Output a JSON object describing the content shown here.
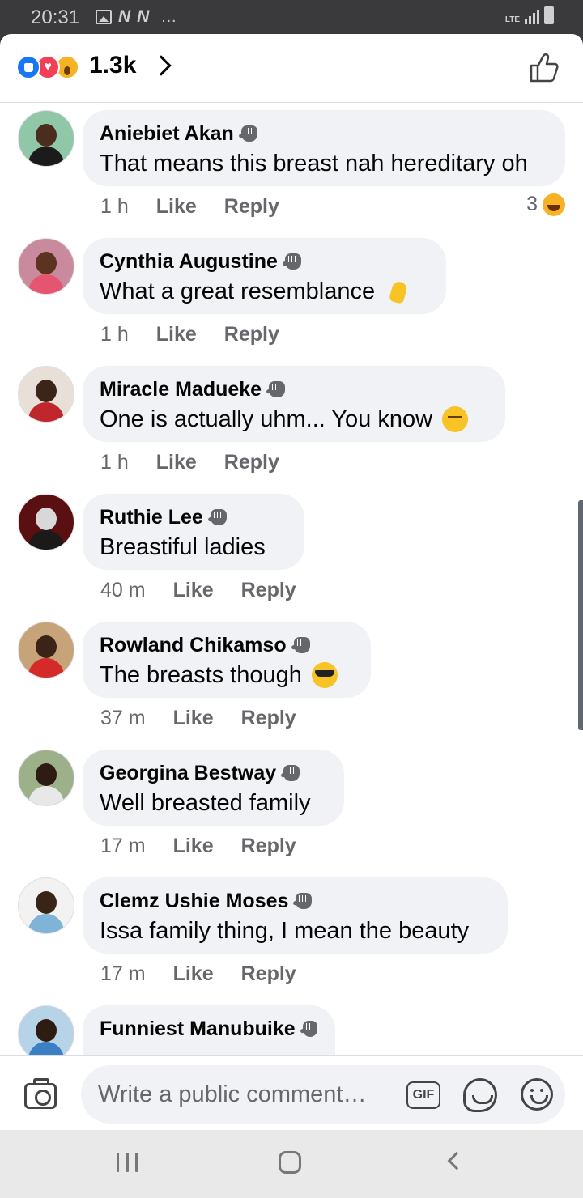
{
  "status_bar": {
    "time": "20:31",
    "network": "LTE",
    "left_icons": [
      "image-icon",
      "n-icon",
      "n-icon",
      "more-dots-icon"
    ],
    "n_glyph": "N",
    "dots": "…"
  },
  "reactions": {
    "count": "1.3k",
    "icons": [
      "like-reaction-icon",
      "love-reaction-icon",
      "wow-reaction-icon"
    ]
  },
  "comments": [
    {
      "name": "Aniebiet Akan",
      "text": "That means this breast nah hereditary oh",
      "time": "1 h",
      "like": "Like",
      "reply": "Reply",
      "reaction_count": "3",
      "emoji": ""
    },
    {
      "name": "Cynthia Augustine",
      "text": "What a great resemblance",
      "time": "1 h",
      "like": "Like",
      "reply": "Reply",
      "emoji": "ok-hand-emoji"
    },
    {
      "name": "Miracle Madueke",
      "text": "One is actually uhm... You know",
      "time": "1 h",
      "like": "Like",
      "reply": "Reply",
      "emoji": "relieved-face-emoji"
    },
    {
      "name": "Ruthie Lee",
      "text": "Breastiful ladies",
      "time": "40 m",
      "like": "Like",
      "reply": "Reply",
      "emoji": ""
    },
    {
      "name": "Rowland Chikamso",
      "text": "The breasts though",
      "time": "37 m",
      "like": "Like",
      "reply": "Reply",
      "emoji": "sunglasses-face-emoji"
    },
    {
      "name": "Georgina Bestway",
      "text": "Well breasted family",
      "time": "17 m",
      "like": "Like",
      "reply": "Reply",
      "emoji": ""
    },
    {
      "name": "Clemz Ushie Moses",
      "text": "Issa family thing, I mean the beauty",
      "time": "17 m",
      "like": "Like",
      "reply": "Reply",
      "emoji": ""
    },
    {
      "name": "Funniest Manubuike",
      "text": "",
      "time": "",
      "like": "",
      "reply": "",
      "emoji": ""
    }
  ],
  "composer": {
    "placeholder": "Write a public comment…",
    "gif_label": "GIF"
  },
  "colors": {
    "brand_blue": "#1877f2",
    "bubble_bg": "#f0f2f5",
    "secondary_text": "#65676b"
  }
}
